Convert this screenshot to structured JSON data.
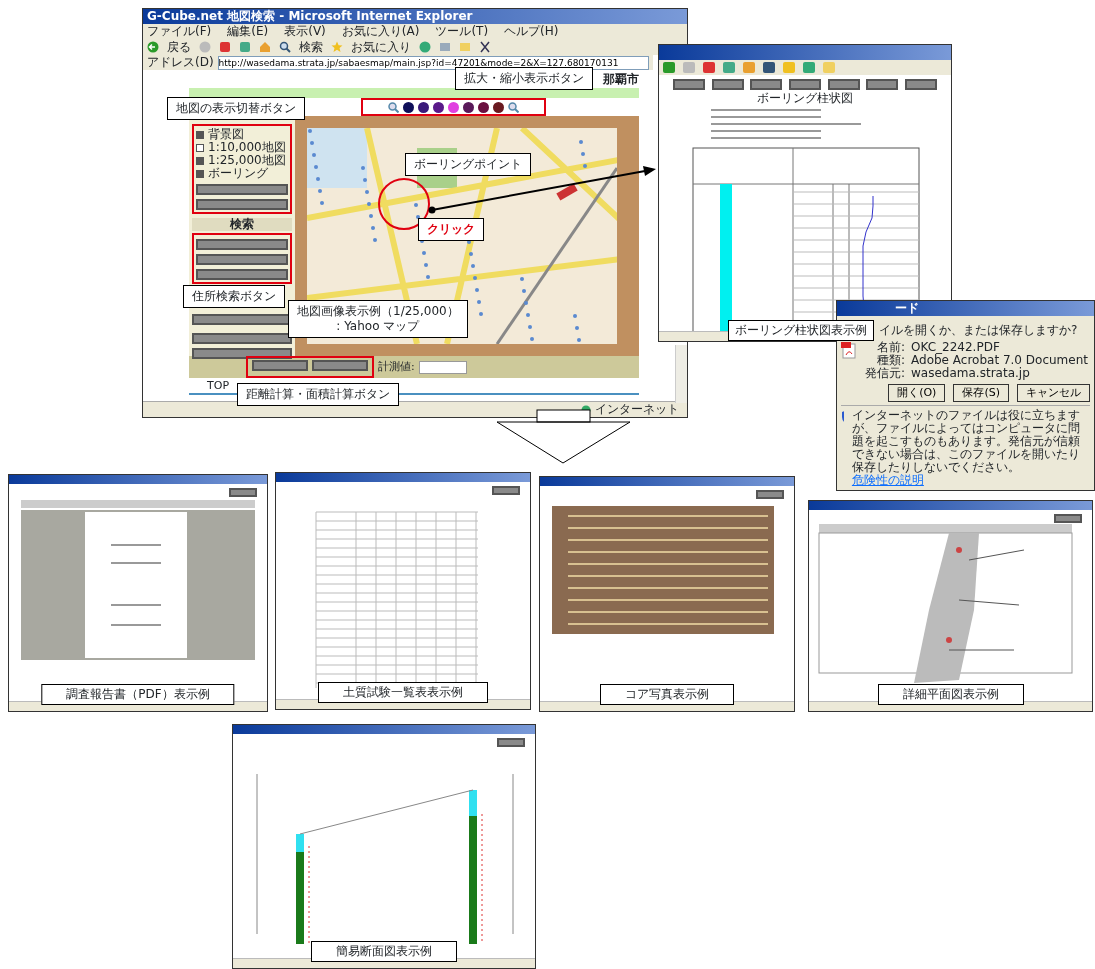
{
  "main_window": {
    "title": "G-Cube.net 地図検索 - Microsoft Internet Explorer",
    "menu": [
      "ファイル(F)",
      "編集(E)",
      "表示(V)",
      "お気に入り(A)",
      "ツール(T)",
      "ヘルプ(H)"
    ],
    "toolbar": {
      "back": "戻る",
      "search": "検索",
      "favorites": "お気に入り"
    },
    "address_label": "アドレス(D)",
    "url": "http://wasedama.strata.jp/sabaesmap/main.jsp?id=47201&mode=2&X=127.680170131",
    "city": "那覇市",
    "zoom_levels": [
      {
        "color": "#10105a"
      },
      {
        "color": "#3a1a7a"
      },
      {
        "color": "#5a1a8a"
      },
      {
        "color": "#e040e0"
      },
      {
        "color": "#5a1a5a"
      },
      {
        "color": "#6a1040"
      },
      {
        "color": "#6a1a20"
      }
    ],
    "layers": [
      {
        "label": "背景図",
        "checked": true
      },
      {
        "label": "1:10,000地図",
        "checked": false
      },
      {
        "label": "1:25,000地図",
        "checked": true
      },
      {
        "label": "ボーリング",
        "checked": true
      }
    ],
    "search_heading": "検索",
    "measure_label": "計測値:",
    "top_link": "TOP",
    "status": "インターネット"
  },
  "callouts": [
    {
      "lines": [
        "拡大・縮小表示ボタン"
      ],
      "kind": "box"
    },
    {
      "lines": [
        "地図の表示切替ボタン"
      ],
      "kind": "box"
    },
    {
      "lines": [
        "ボーリングポイント"
      ],
      "kind": "box"
    },
    {
      "lines": [
        "クリック"
      ],
      "kind": "alert"
    },
    {
      "lines": [
        "住所検索ボタン"
      ],
      "kind": "box"
    },
    {
      "lines": [
        "地図画像表示例（1/25,000）",
        ": Yahoo マップ"
      ],
      "kind": "box"
    },
    {
      "lines": [
        "距離計算・面積計算ボタン"
      ],
      "kind": "box"
    }
  ],
  "boring_window": {
    "title": "ボーリング柱状図",
    "caption": "ボーリング柱状図表示例"
  },
  "download_dialog": {
    "title": "ード",
    "question": "イルを開くか、または保存しますか?",
    "fields": [
      {
        "label": "名前:",
        "value": "OKC_2242.PDF"
      },
      {
        "label": "種類:",
        "value": "Adobe Acrobat 7.0 Document"
      },
      {
        "label": "発信元:",
        "value": "wasedama.strata.jp"
      }
    ],
    "buttons": [
      "開く(O)",
      "保存(S)",
      "キャンセル"
    ],
    "warning": "インターネットのファイルは役に立ちますが、ファイルによってはコンピュータに問題を起こすものもあります。発信元が信頼できない場合は、このファイルを開いたり保存したりしないでください。",
    "warning_link": "危険性の説明"
  },
  "examples": [
    {
      "kind": "pdf",
      "caption": "調査報告書（PDF）表示例"
    },
    {
      "kind": "table",
      "caption": "土質試験一覧表表示例"
    },
    {
      "kind": "photo",
      "caption": "コア写真表示例"
    },
    {
      "kind": "plan",
      "caption": "詳細平面図表示例"
    },
    {
      "kind": "section",
      "caption": "簡易断面図表示例"
    }
  ]
}
